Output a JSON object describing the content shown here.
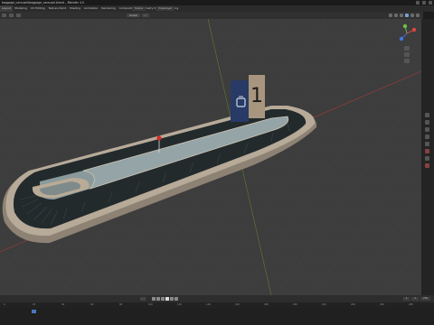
{
  "window": {
    "title": "baggage_carousel/baggage_carousel.blend – Blender 4.0"
  },
  "menu": {
    "items": [
      "Layout",
      "Modeling",
      "UV Editing",
      "Texture Paint",
      "Shading",
      "Animation",
      "Rendering",
      "Compositing",
      "Geometry Nodes",
      "Scripting"
    ],
    "scene_label": "Scene",
    "view_layer_label": "ViewLayer"
  },
  "viewport_header": {
    "mode_label": "Global",
    "options_label": "Options"
  },
  "scene": {
    "sign_number": "1",
    "sign_color": "#283a66",
    "sign_panel_color": "#a8957e",
    "belt_color": "#222a2c",
    "rim_color": "#b7aa98",
    "center_color": "#8a9a9c",
    "background_color": "#3d3d3d",
    "x_axis_color": "#a04444",
    "y_axis_color": "#6b8a3a"
  },
  "timeline": {
    "current_frame": "1",
    "start_frame": "1",
    "end_frame": "250",
    "ruler": [
      "0",
      "20",
      "40",
      "60",
      "80",
      "100",
      "120",
      "140",
      "160",
      "180",
      "200",
      "220",
      "240",
      "260",
      "280"
    ]
  }
}
